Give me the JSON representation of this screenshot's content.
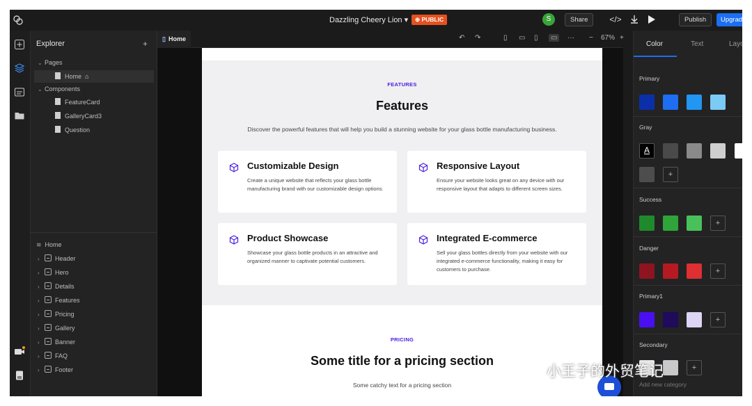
{
  "topbar": {
    "project_title": "Dazzling Cheery Lion ▾",
    "public_badge": "⊕ PUBLIC",
    "avatar_initial": "S",
    "share_label": "Share",
    "code_icon": "</>",
    "publish_label": "Publish",
    "upgrade_label": "Upgrad"
  },
  "explorer": {
    "title": "Explorer",
    "add": "+",
    "pages_label": "Pages",
    "home_page": "Home",
    "components_label": "Components",
    "components": [
      "FeatureCard",
      "GalleryCard3",
      "Question"
    ],
    "layers_root": "Home",
    "layers": [
      "Header",
      "Hero",
      "Details",
      "Features",
      "Pricing",
      "Gallery",
      "Banner",
      "FAQ",
      "Footer"
    ]
  },
  "tabs": {
    "home": "Home"
  },
  "toolbar": {
    "zoom_minus": "−",
    "zoom": "67%",
    "zoom_plus": "+",
    "more": "···"
  },
  "canvas": {
    "features_eyebrow": "FEATURES",
    "features_title": "Features",
    "features_lead": "Discover the powerful features that will help you build a stunning website for your glass bottle manufacturing business.",
    "cards": [
      {
        "title": "Customizable Design",
        "desc": "Create a unique website that reflects your glass bottle manufacturing brand with our customizable design options."
      },
      {
        "title": "Responsive Layout",
        "desc": "Ensure your website looks great on any device with our responsive layout that adapts to different screen sizes."
      },
      {
        "title": "Product Showcase",
        "desc": "Showcase your glass bottle products in an attractive and organized manner to captivate potential customers."
      },
      {
        "title": "Integrated E-commerce",
        "desc": "Sell your glass bottles directly from your website with our integrated e-commerce functionality, making it easy for customers to purchase."
      }
    ],
    "pricing_eyebrow": "PRICING",
    "pricing_title": "Some title for a pricing section",
    "pricing_lead": "Some catchy text for a pricing section"
  },
  "rpanel": {
    "tabs": [
      "Color",
      "Text",
      "Layo"
    ],
    "sections": {
      "primary": {
        "label": "Primary",
        "colors": [
          "#0a2fa8",
          "#1d6ef2",
          "#2196f3",
          "#7ccbf5"
        ]
      },
      "gray": {
        "label": "Gray",
        "text_swatch": "A",
        "colors": [
          "#4a4a4a",
          "#8a8a8a",
          "#cfcfcf",
          "#4d4d4d"
        ]
      },
      "success": {
        "label": "Success",
        "colors": [
          "#1f8a2b",
          "#2ea43a",
          "#48c15a"
        ]
      },
      "danger": {
        "label": "Danger",
        "colors": [
          "#8e1520",
          "#b51a22",
          "#de2f32"
        ]
      },
      "primary1": {
        "label": "Primary1",
        "colors": [
          "#4a0ff0",
          "#1f0a5c",
          "#dcd5f5"
        ]
      },
      "secondary": {
        "label": "Secondary",
        "colors": [
          "#e8e8ea",
          "#c9c9cc"
        ]
      }
    },
    "add_new_category": "Add new category"
  },
  "watermark": "小王子的外贸笔记"
}
